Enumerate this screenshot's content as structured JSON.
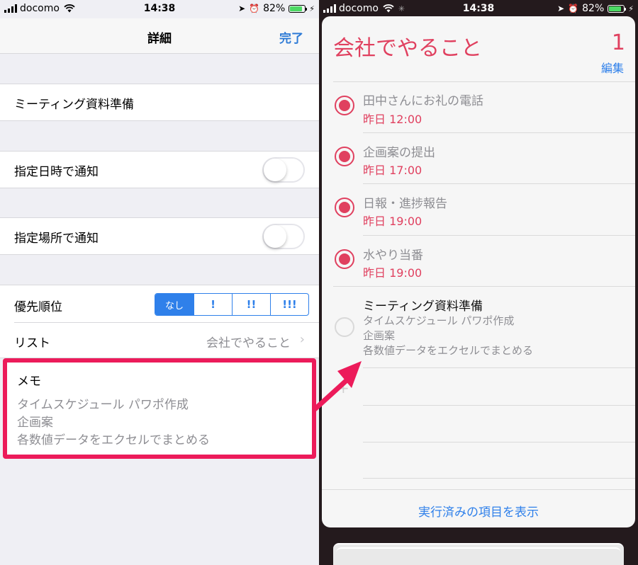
{
  "left": {
    "status": {
      "carrier": "docomo",
      "time": "14:38",
      "battery": "82%"
    },
    "nav": {
      "title": "詳細",
      "done": "完了"
    },
    "task_title": "ミーティング資料準備",
    "notify_time_label": "指定日時で通知",
    "notify_place_label": "指定場所で通知",
    "priority": {
      "label": "優先順位",
      "options": [
        "なし",
        "!",
        "!!",
        "!!!"
      ],
      "selected": "なし"
    },
    "list": {
      "label": "リスト",
      "value": "会社でやること"
    },
    "memo": {
      "label": "メモ",
      "lines": [
        "タイムスケジュール パワポ作成",
        "企画案",
        "各数値データをエクセルでまとめる"
      ]
    }
  },
  "right": {
    "status": {
      "carrier": "docomo",
      "time": "14:38",
      "battery": "82%"
    },
    "list_title": "会社でやること",
    "count": "1",
    "edit": "編集",
    "items": [
      {
        "title": "田中さんにお礼の電話",
        "due": "昨日 12:00",
        "completed": true
      },
      {
        "title": "企画案の提出",
        "due": "昨日 17:00",
        "completed": true
      },
      {
        "title": "日報・進捗報告",
        "due": "昨日 19:00",
        "completed": true
      },
      {
        "title": "水やり当番",
        "due": "昨日 19:00",
        "completed": true
      }
    ],
    "open_item": {
      "title": "ミーティング資料準備",
      "notes": [
        "タイムスケジュール パワポ作成",
        "企画案",
        "各数値データをエクセルでまとめる"
      ]
    },
    "add_symbol": "+",
    "show_completed": "実行済みの項目を表示"
  },
  "colors": {
    "accent_red": "#e0405f",
    "ios_blue": "#2f80ea",
    "highlight": "#ec1b5a"
  }
}
